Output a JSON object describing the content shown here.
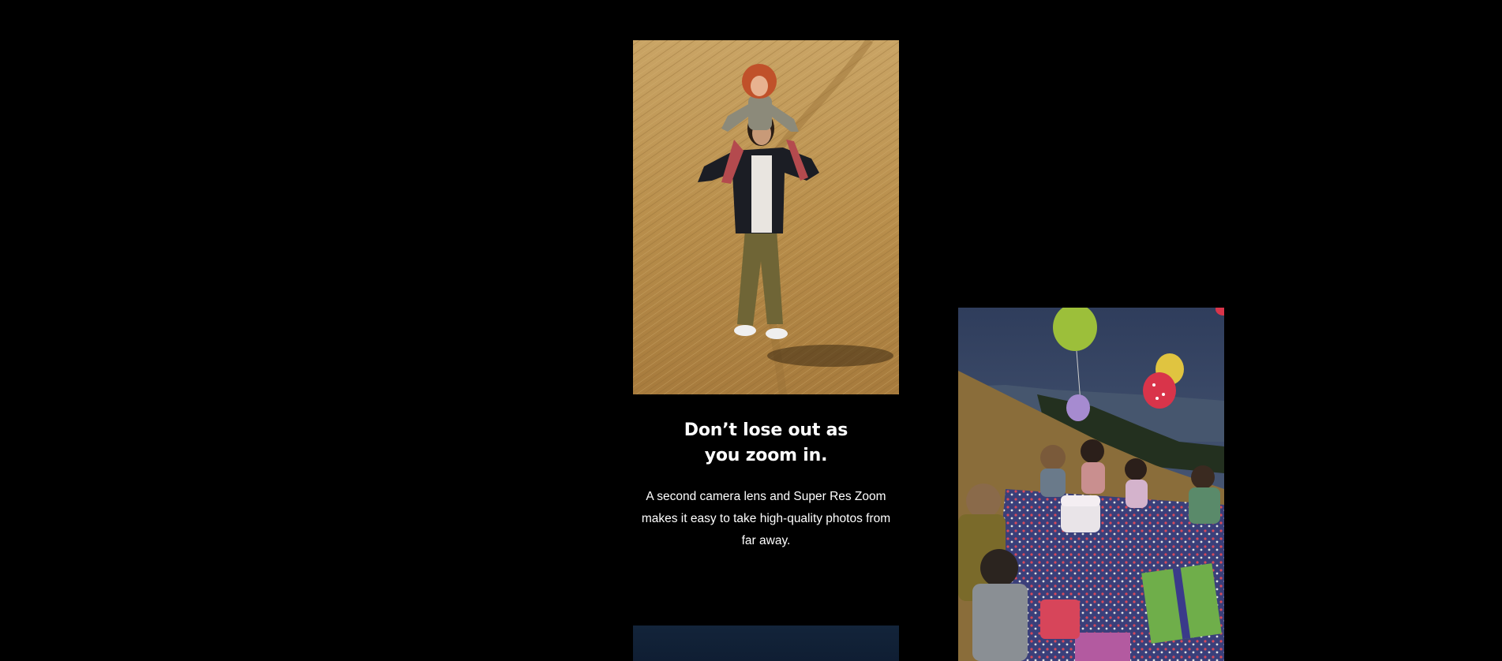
{
  "feature": {
    "heading": "Don’t lose out as you zoom in.",
    "body": "A second camera lens and Super Res Zoom makes it easy to take high-quality photos from far away."
  },
  "images": {
    "hill_photo": {
      "alt": "Man carrying child on shoulders walking down a grassy hillside"
    },
    "party_photo": {
      "alt": "Children at an outdoor birthday picnic with balloons and cake"
    },
    "next_photo": {
      "alt": "Next feature photo"
    }
  },
  "colors": {
    "background": "#000000",
    "text": "#ffffff"
  }
}
